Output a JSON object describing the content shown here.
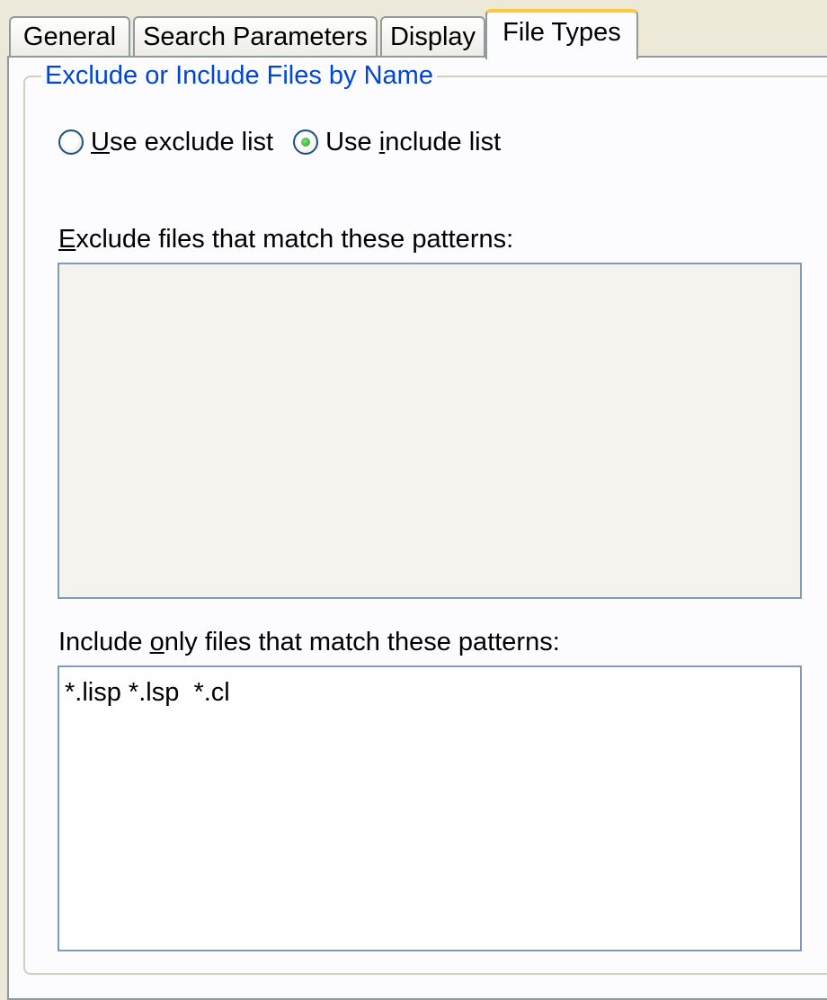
{
  "tabs": [
    {
      "label": "General",
      "active": false
    },
    {
      "label": "Search Parameters",
      "active": false
    },
    {
      "label": "Display",
      "active": false
    },
    {
      "label": "File Types",
      "active": true
    }
  ],
  "group": {
    "title": "Exclude or Include Files by Name"
  },
  "radios": {
    "exclude": {
      "label": "Use exclude list",
      "mnemonic": "U",
      "checked": false
    },
    "include": {
      "label": "Use include list",
      "mnemonic": "i",
      "checked": true
    }
  },
  "exclude_field": {
    "label": "Exclude files that match these patterns:",
    "value": "",
    "enabled": false
  },
  "include_field": {
    "label": "Include only files that match these patterns:",
    "value": "*.lisp *.lsp  *.cl",
    "enabled": true
  },
  "colors": {
    "group_title": "#0046d5",
    "active_tab_accent": "#ffc83c",
    "radio_selected": "#21a121"
  }
}
